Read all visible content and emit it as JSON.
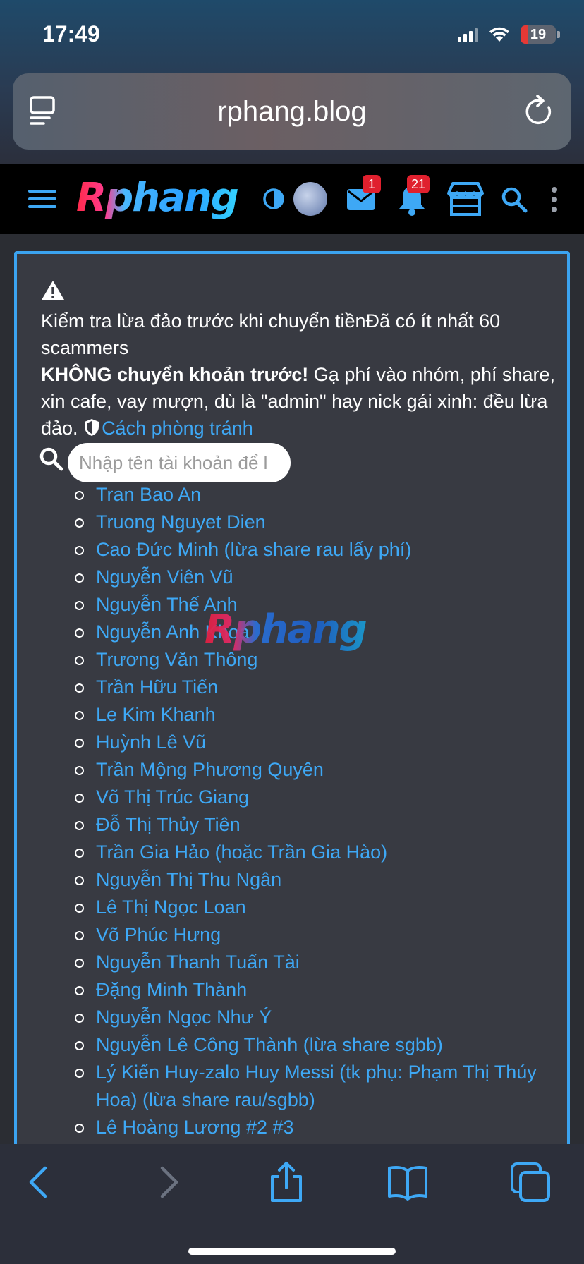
{
  "status_bar": {
    "time": "17:49",
    "battery": "19"
  },
  "browser": {
    "url": "rphang.blog"
  },
  "header": {
    "logo": "Rphang",
    "mail_badge": "1",
    "notification_badge": "21"
  },
  "notice": {
    "line1": "Kiểm tra lừa đảo trước khi chuyển tiềnĐã có ít nhất 60 scammers",
    "bold": "KHÔNG chuyển khoản trước!",
    "rest": " Gạ phí vào nhóm, phí share, xin cafe, vay mượn, dù là \"admin\" hay nick gái xinh: đều lừa đảo. ",
    "link": "Cách phòng tránh"
  },
  "search": {
    "placeholder": "Nhập tên tài khoản để l"
  },
  "scammers": [
    "Tran Bao An",
    "Truong Nguyet Dien",
    "Cao Đức Minh (lừa share rau lấy phí)",
    "Nguyễn Viên Vũ",
    "Nguyễn Thế Anh",
    "Nguyễn Anh Khoa",
    "Trương Văn Thông",
    "Trần Hữu Tiến",
    "Le Kim Khanh",
    "Huỳnh Lê Vũ",
    "Trần Mộng Phương Quyên",
    "Võ Thị Trúc Giang",
    "Đỗ Thị Thủy Tiên",
    "Trần Gia Hảo (hoặc Trần Gia Hào)",
    "Nguyễn Thị Thu Ngân",
    "Lê Thị Ngọc Loan",
    "Võ Phúc Hưng",
    "Nguyễn Thanh Tuấn Tài",
    "Đặng Minh Thành",
    "Nguyễn Ngọc Như Ý",
    "Nguyễn Lê Công Thành (lừa share sgbb)",
    "Lý Kiến Huy-zalo Huy Messi (tk phụ: Phạm Thị Thúy Hoa) (lừa share rau/sgbb)",
    "Lê Hoàng Lương #2 #3"
  ],
  "watermark": "Rphang",
  "colors": {
    "accent": "#3ea8f5",
    "border": "#3ba3f0",
    "badge": "#e0202e",
    "panel": "#383a42"
  },
  "icons": [
    "tabs-icon",
    "reload-icon",
    "menu-icon",
    "theme-toggle-icon",
    "mail-icon",
    "bell-icon",
    "store-icon",
    "search-icon",
    "more-icon",
    "warning-icon",
    "shield-icon",
    "back-icon",
    "forward-icon",
    "share-icon",
    "bookmarks-icon",
    "tabs-overview-icon"
  ]
}
